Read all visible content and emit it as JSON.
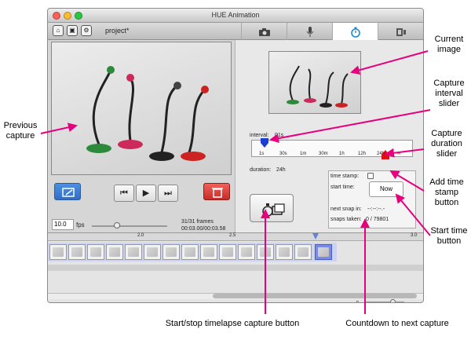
{
  "window": {
    "title": "HUE Animation",
    "project_name": "project*"
  },
  "tabs": [
    {
      "name": "camera",
      "icon": "camera-icon",
      "active": false
    },
    {
      "name": "microphone",
      "icon": "microphone-icon",
      "active": false
    },
    {
      "name": "timelapse",
      "icon": "stopwatch-icon",
      "active": true
    },
    {
      "name": "export",
      "icon": "film-export-icon",
      "active": false
    }
  ],
  "playback": {
    "fps_value": "10.0",
    "fps_label": "fps",
    "frames": "31/31 frames",
    "time": "00:03.00/00:03.58"
  },
  "timelapse": {
    "interval_label": "interval:",
    "interval_value": "01s",
    "ticks": [
      "1s",
      "30s",
      "1m",
      "30m",
      "1h",
      "12h",
      "24h",
      "∞"
    ],
    "duration_label": "duration:",
    "duration_value": "24h",
    "timestamp_label": "time stamp:",
    "start_time_label": "start time:",
    "now_button": "Now",
    "next_snap_label": "next snap in:",
    "next_snap_value": "--:--:--.-",
    "snaps_taken_label": "snaps taken:",
    "snaps_taken_value": "0 / 79801"
  },
  "timeline": {
    "markers": [
      "2.0",
      "2.5",
      "3.0"
    ]
  },
  "annotations": {
    "current_image": "Current image",
    "capture_interval": "Capture interval slider",
    "previous_capture": "Previous capture",
    "capture_duration": "Capture duration slider",
    "add_timestamp": "Add time stamp button",
    "start_time": "Start time button",
    "start_stop": "Start/stop timelapse capture button",
    "countdown": "Countdown to next capture"
  },
  "colors": {
    "annotation_arrow": "#e6007e",
    "accent_blue": "#1a8ad4"
  }
}
